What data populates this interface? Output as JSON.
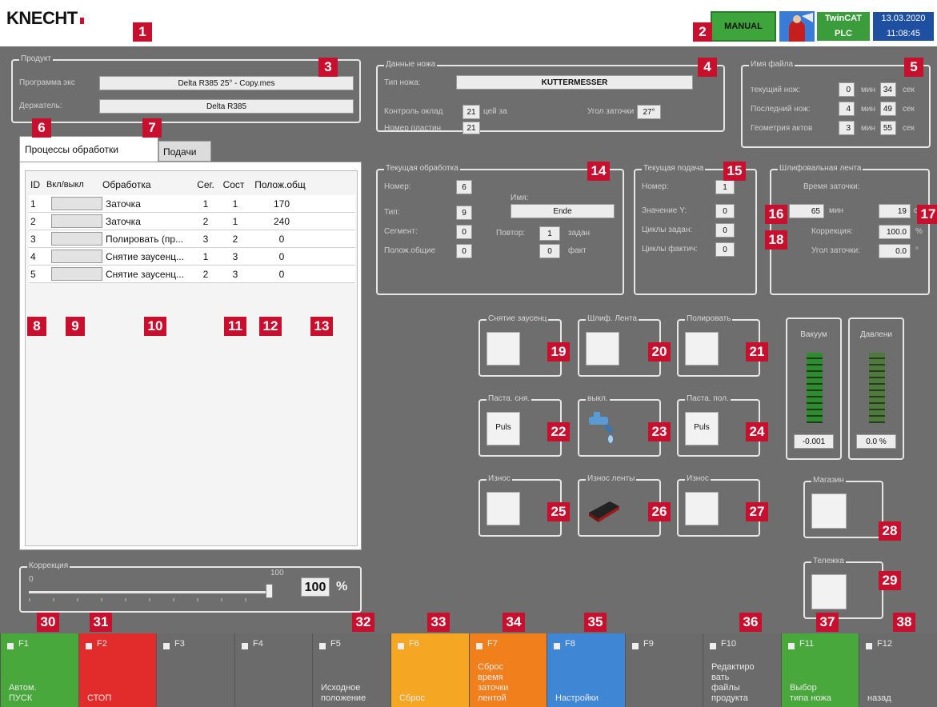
{
  "header": {
    "logo": "KNECHT",
    "mode": "MANUAL",
    "brand_top": "TwinCAT",
    "brand_bottom": "PLC",
    "date": "13.03.2020",
    "time": "11:08:45"
  },
  "product": {
    "title": "Продукт",
    "program_label": "Программа экс",
    "program_value": "Delta R385 25° - Copy.mes",
    "holder_label": "Держатель:",
    "holder_value": "Delta R385"
  },
  "knife": {
    "title": "Данные ножа",
    "type_label": "Тип ножа:",
    "type_value": "KUTTERMESSER",
    "control_label": "Контроль оклад",
    "control_value": "21",
    "control_suffix": "цей за",
    "plate_label": "Номер пластин",
    "plate_value": "21",
    "angle_label": "Угол заточки",
    "angle_value": "27°"
  },
  "filename": {
    "title": "Имя файла",
    "rows": [
      {
        "label": "текущий нож:",
        "min": "0",
        "min_unit": "мин",
        "sec": "34",
        "sec_unit": "сек"
      },
      {
        "label": "Последний нож:",
        "min": "4",
        "min_unit": "мин",
        "sec": "49",
        "sec_unit": "сек"
      },
      {
        "label": "Геометрия актов",
        "min": "3",
        "min_unit": "мин",
        "sec": "55",
        "sec_unit": "сек"
      }
    ]
  },
  "tabs": {
    "active": "Процессы обработки",
    "other": "Подачи"
  },
  "table": {
    "headers": [
      "ID",
      "Вкл/выкл",
      "Обработка",
      "Сег.",
      "Сост",
      "Полож.общ"
    ],
    "rows": [
      {
        "id": "1",
        "proc": "Заточка",
        "seg": "1",
        "state": "1",
        "pos": "170"
      },
      {
        "id": "2",
        "proc": "Заточка",
        "seg": "2",
        "state": "1",
        "pos": "240"
      },
      {
        "id": "3",
        "proc": "Полировать (пр...",
        "seg": "3",
        "state": "2",
        "pos": "0"
      },
      {
        "id": "4",
        "proc": "Снятие заусенц...",
        "seg": "1",
        "state": "3",
        "pos": "0"
      },
      {
        "id": "5",
        "proc": "Снятие заусенц...",
        "seg": "2",
        "state": "3",
        "pos": "0"
      }
    ]
  },
  "correction": {
    "title": "Коррекция",
    "min": "0",
    "max": "100",
    "value": "100",
    "unit": "%",
    "level": 1.0
  },
  "current_proc": {
    "title": "Текущая обработка",
    "num_label": "Номер:",
    "num_value": "6",
    "type_label": "Тип:",
    "type_value": "9",
    "seg_label": "Сегмент:",
    "seg_value": "0",
    "pos_label": "Полож.общие",
    "pos_value": "0",
    "name_label": "Имя:",
    "name_value": "Ende",
    "repeat_label": "Повтор:",
    "repeat_set": "1",
    "repeat_set_label": "задан",
    "repeat_act": "0",
    "repeat_act_label": "факт"
  },
  "current_feed": {
    "title": "Текущая подача",
    "num_label": "Номер:",
    "num_value": "1",
    "y_label": "Значение Y:",
    "y_value": "0",
    "cycles_set_label": "Циклы задан:",
    "cycles_set_value": "0",
    "cycles_act_label": "Циклы фактич:",
    "cycles_act_value": "0"
  },
  "belt": {
    "title": "Шлифовальная лента",
    "time_label": "Время заточки:",
    "min_value": "65",
    "min_unit": "мин",
    "sec_value": "19",
    "sec_unit": "сек",
    "corr_label": "Коррекция:",
    "corr_value": "100.0",
    "corr_unit": "%",
    "angle_label": "Угол заточки:",
    "angle_value": "0.0",
    "angle_unit": "°"
  },
  "buttons": {
    "deburr": "Снятие заусенц",
    "belt": "Шлиф. Лента",
    "polish": "Полировать",
    "paste_deburr": "Паста. сня.",
    "paste_deburr_btn": "Puls",
    "off": "выкл.",
    "paste_polish": "Паста. пол.",
    "paste_polish_btn": "Puls",
    "wear1": "Износ",
    "wear_belt": "Износ ленты",
    "wear2": "Износ",
    "magazine": "Магазин",
    "cart": "Тележка"
  },
  "gauges": {
    "vacuum_label": "Вакуум",
    "vacuum_value": "-0.001",
    "pressure_label": "Давлени",
    "pressure_value": "0.0 %"
  },
  "fkeys": [
    {
      "fn": "F1",
      "text": "Автом.\nПУСК",
      "color": "#49a83b"
    },
    {
      "fn": "F2",
      "text": "СТОП",
      "color": "#e22b2b"
    },
    {
      "fn": "F3",
      "text": "",
      "color": "#6b6b6b"
    },
    {
      "fn": "F4",
      "text": "",
      "color": "#6b6b6b"
    },
    {
      "fn": "F5",
      "text": "Исходное\nположение",
      "color": "#6b6b6b"
    },
    {
      "fn": "F6",
      "text": "Сброс",
      "color": "#f5a623"
    },
    {
      "fn": "F7",
      "text": "Сброс\nвремя\nзаточки\nлентой",
      "color": "#f07f1c"
    },
    {
      "fn": "F8",
      "text": "Настройки",
      "color": "#3f86d4"
    },
    {
      "fn": "F9",
      "text": "",
      "color": "#6b6b6b"
    },
    {
      "fn": "F10",
      "text": "Редактиро\nвать\nфайлы\nпродукта",
      "color": "#6b6b6b"
    },
    {
      "fn": "F11",
      "text": "Выбор\nтипа ножа",
      "color": "#49a83b"
    },
    {
      "fn": "F12",
      "text": "назад",
      "color": "#6b6b6b"
    }
  ],
  "markers": [
    "1",
    "2",
    "3",
    "4",
    "5",
    "6",
    "7",
    "8",
    "9",
    "10",
    "11",
    "12",
    "13",
    "14",
    "15",
    "16",
    "17",
    "18",
    "19",
    "20",
    "21",
    "22",
    "23",
    "24",
    "25",
    "26",
    "27",
    "28",
    "29",
    "30",
    "31",
    "32",
    "33",
    "34",
    "35",
    "36",
    "37",
    "38"
  ]
}
